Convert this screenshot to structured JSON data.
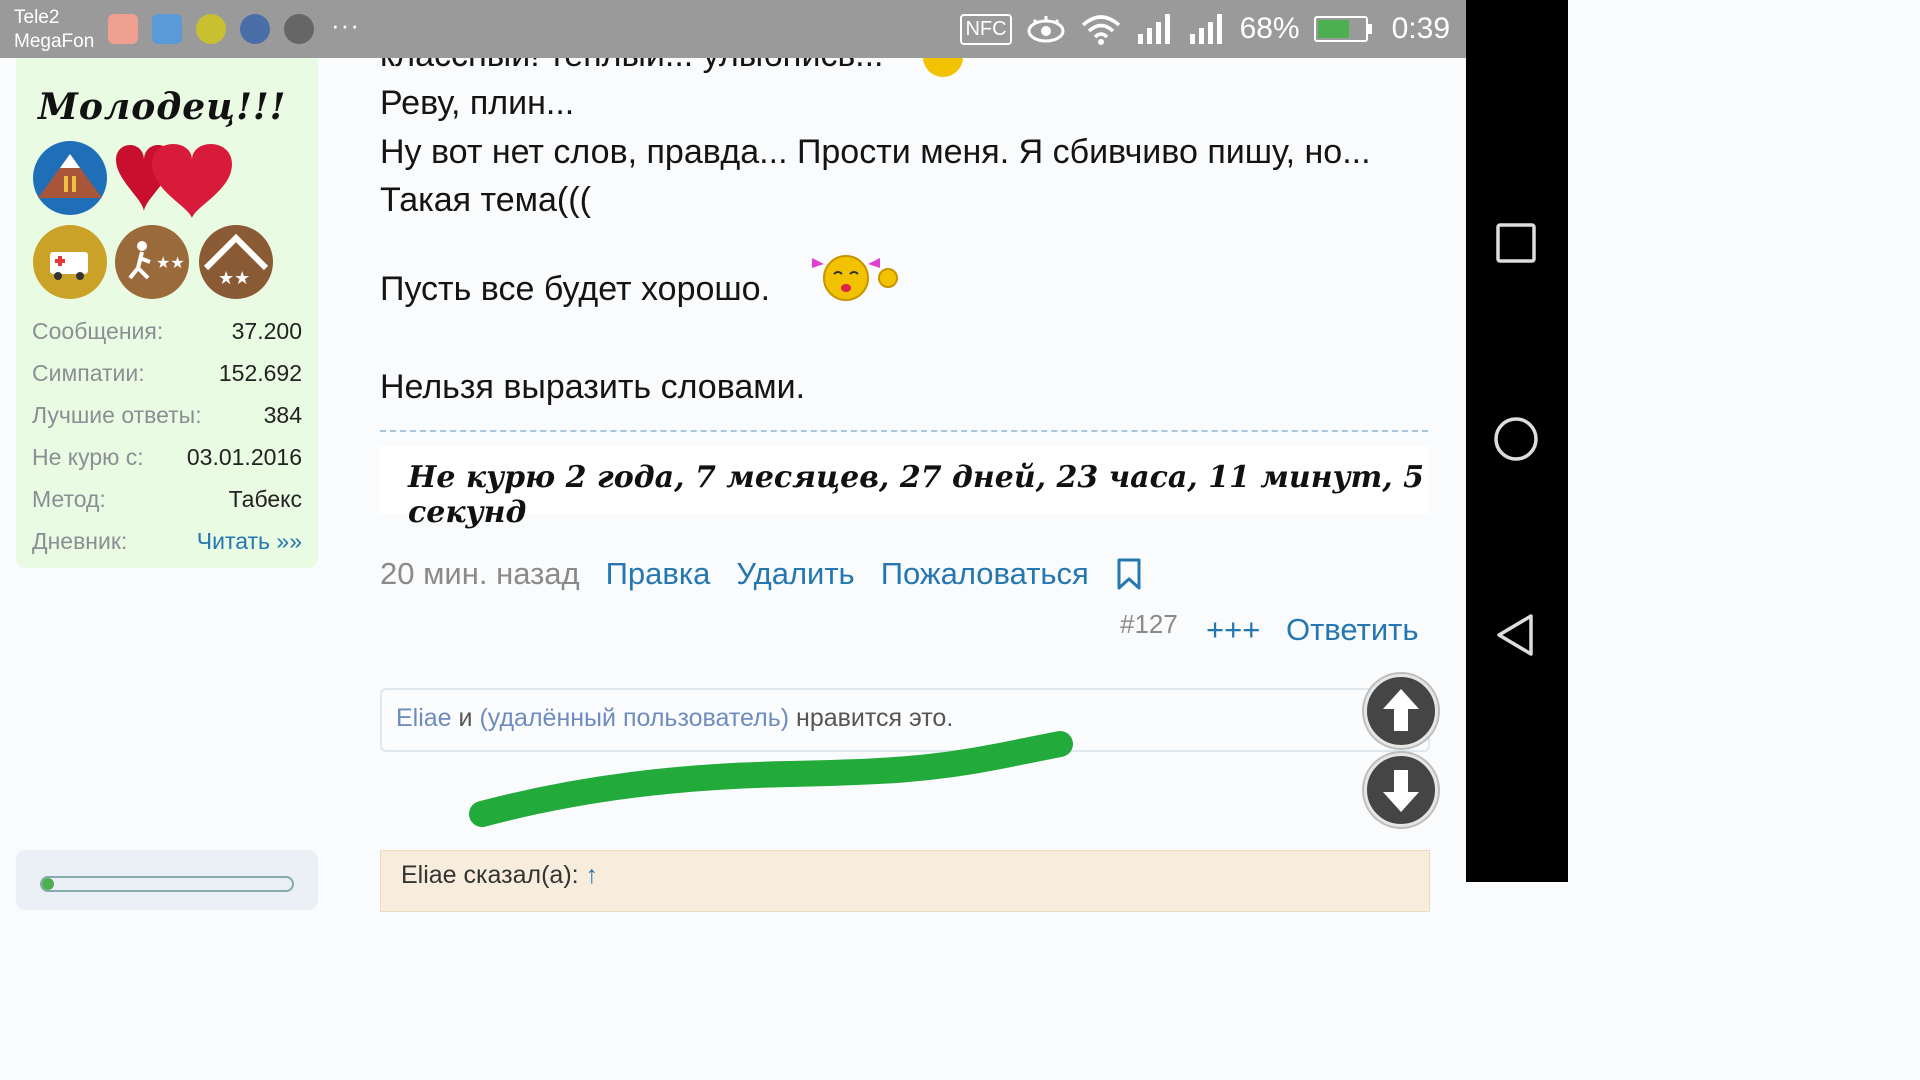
{
  "status_bar": {
    "carrier_1": "Tele2",
    "carrier_2": "MegaFon",
    "more": "···",
    "nfc": "NFC",
    "battery": "68%",
    "time": "0:39",
    "app_icons": [
      "mail-app-icon",
      "health-app-icon",
      "tennis-ball-app-icon",
      "globe-app-icon",
      "avatar-app-icon"
    ]
  },
  "sidebar": {
    "title_badge": "Молодец!!!",
    "stats": [
      {
        "label": "Сообщения:",
        "value": "37.200"
      },
      {
        "label": "Симпатии:",
        "value": "152.692"
      },
      {
        "label": "Лучшие ответы:",
        "value": "384"
      },
      {
        "label": "Не курю с:",
        "value": "03.01.2016"
      },
      {
        "label": "Метод:",
        "value": "Табекс"
      },
      {
        "label": "Дневник:",
        "value": "Читать »»"
      }
    ]
  },
  "post": {
    "lines": [
      "классный! теплый... улыбнись...",
      "Реву, плин...",
      "Ну вот нет слов, правда... Прости меня. Я сбивчиво пишу, но...",
      "Такая тема(((",
      "Пусть все будет хорошо.",
      "Нельзя выразить словами."
    ],
    "signature": "Не курю  2 года, 7 месяцев, 27 дней, 23 часа, 11 минут, 5 секунд",
    "time": "20 мин. назад",
    "edit": "Правка",
    "delete": "Удалить",
    "report": "Пожаловаться",
    "number": "#127",
    "plus": "+++",
    "reply": "Ответить"
  },
  "likes": {
    "user1": "Eliae",
    "and": "и",
    "user2": "(удалённый пользователь)",
    "suffix": "нравится это."
  },
  "quote": {
    "author": "Eliae сказал(а):",
    "arrow": "↑"
  },
  "colors": {
    "link": "#2577b1",
    "sidebar_bg": "#eafbe3",
    "highlight": "#22aa3a"
  }
}
